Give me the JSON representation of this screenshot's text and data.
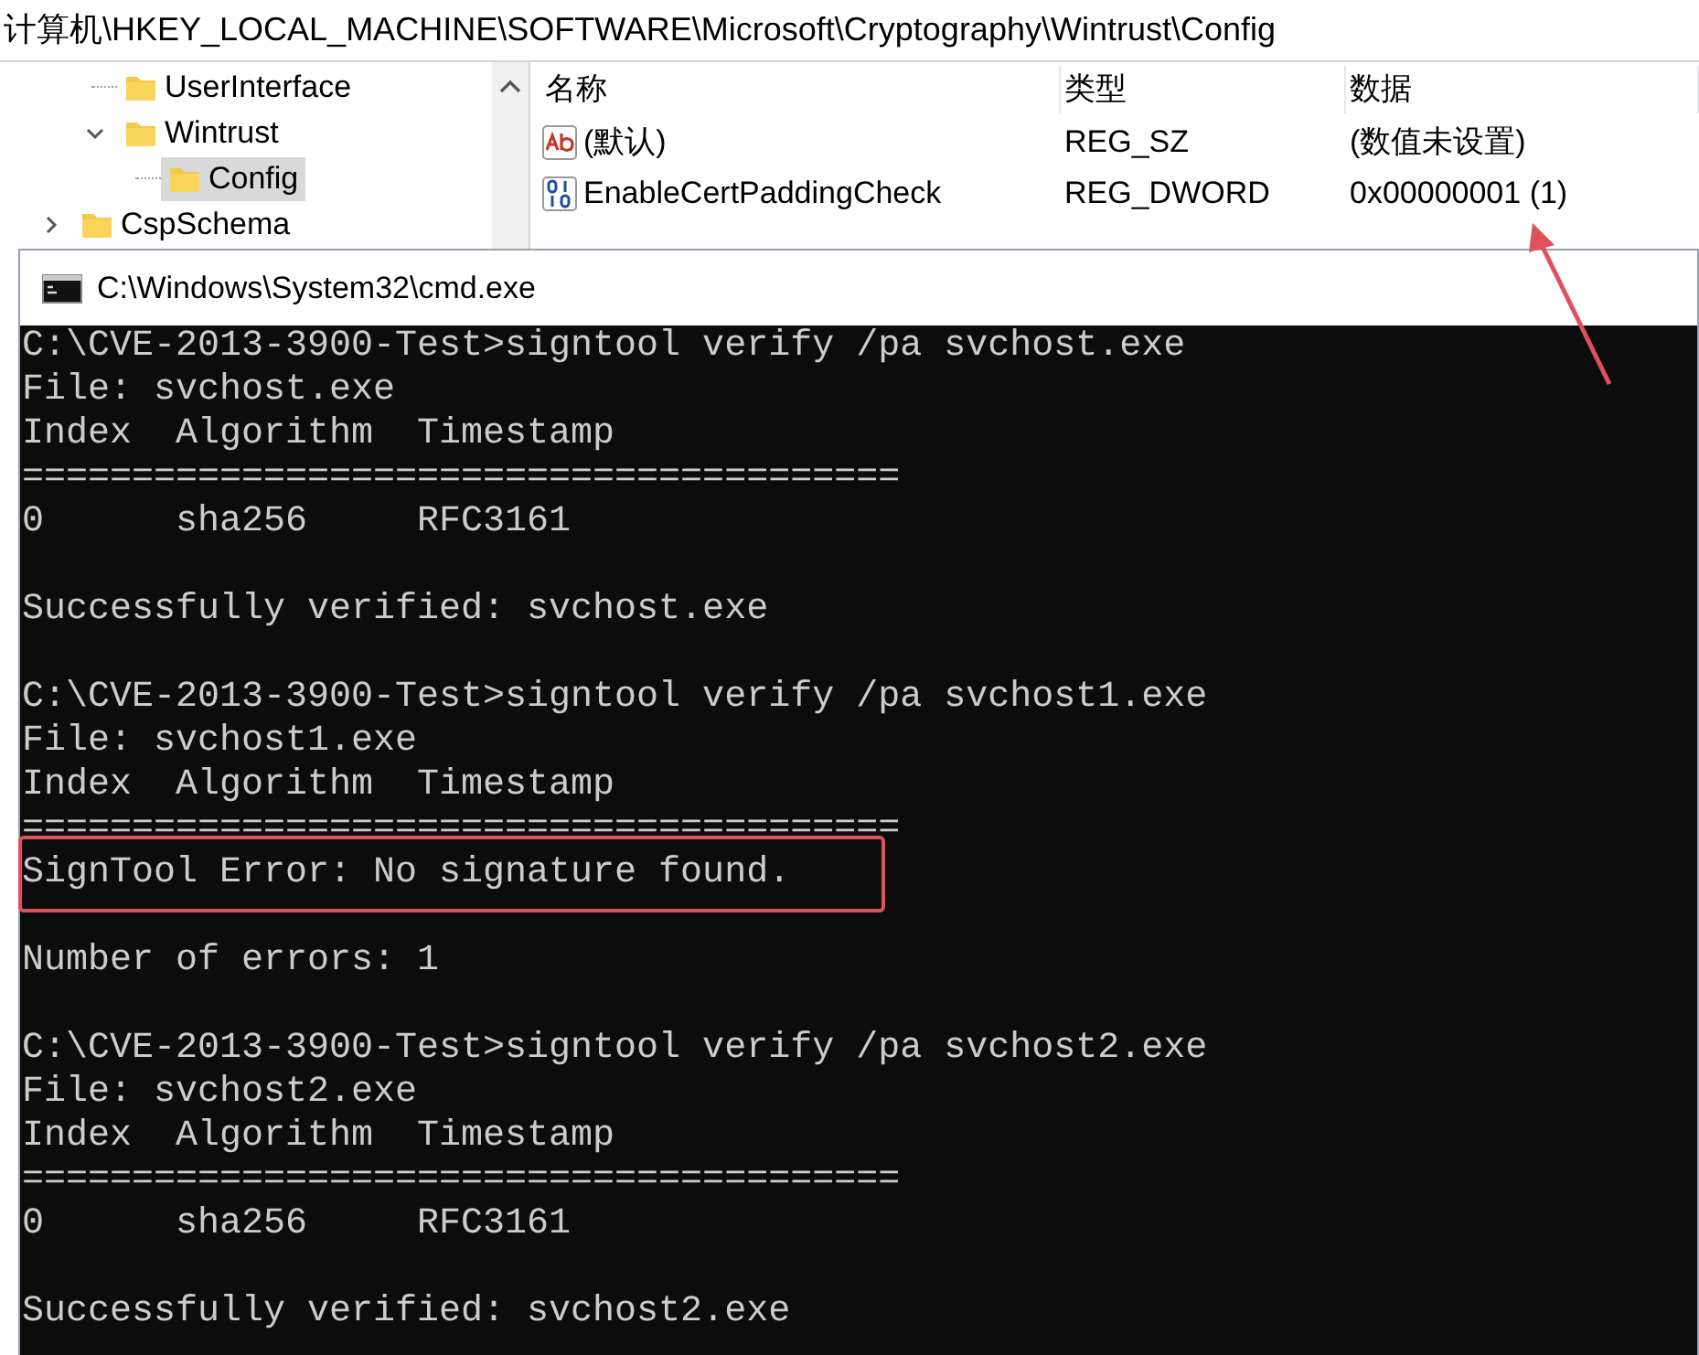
{
  "address_bar": "计算机\\HKEY_LOCAL_MACHINE\\SOFTWARE\\Microsoft\\Cryptography\\Wintrust\\Config",
  "tree": {
    "items": [
      {
        "kind": "hidden_parent",
        "children": [
          {
            "kind": "folder",
            "label": "UserInterface",
            "selected": false
          },
          {
            "kind": "folder",
            "label": "Wintrust",
            "expanded": true,
            "selected": false,
            "children": [
              {
                "kind": "folder",
                "label": "Config",
                "selected": true
              }
            ]
          }
        ]
      },
      {
        "kind": "folder",
        "label": "CspSchema",
        "expanded": false,
        "selected": false
      }
    ]
  },
  "values_list": {
    "columns": [
      "名称",
      "类型",
      "数据"
    ],
    "rows": [
      {
        "kind": "string",
        "name": "(默认)",
        "type": "REG_SZ",
        "data": "(数值未设置)"
      },
      {
        "kind": "binary",
        "name": "EnableCertPaddingCheck",
        "type": "REG_DWORD",
        "data": "0x00000001 (1)"
      }
    ]
  },
  "console": {
    "title": "C:\\Windows\\System32\\cmd.exe",
    "lines": [
      {
        "kind": "line",
        "text": "C:\\CVE-2013-3900-Test>signtool verify /pa svchost.exe"
      },
      {
        "kind": "line",
        "text": "File: svchost.exe"
      },
      {
        "kind": "line",
        "text": "Index  Algorithm  Timestamp"
      },
      {
        "kind": "line",
        "text": "========================================"
      },
      {
        "kind": "line",
        "text": "0      sha256     RFC3161"
      },
      {
        "kind": "blank"
      },
      {
        "kind": "line",
        "text": "Successfully verified: svchost.exe"
      },
      {
        "kind": "blank"
      },
      {
        "kind": "line",
        "text": "C:\\CVE-2013-3900-Test>signtool verify /pa svchost1.exe"
      },
      {
        "kind": "line",
        "text": "File: svchost1.exe"
      },
      {
        "kind": "line",
        "text": "Index  Algorithm  Timestamp"
      },
      {
        "kind": "line",
        "text": "========================================"
      },
      {
        "kind": "highlighted",
        "text": "SignTool Error: No signature found."
      },
      {
        "kind": "blank"
      },
      {
        "kind": "line",
        "text": "Number of errors: 1"
      },
      {
        "kind": "blank"
      },
      {
        "kind": "line",
        "text": "C:\\CVE-2013-3900-Test>signtool verify /pa svchost2.exe"
      },
      {
        "kind": "line",
        "text": "File: svchost2.exe"
      },
      {
        "kind": "line",
        "text": "Index  Algorithm  Timestamp"
      },
      {
        "kind": "line",
        "text": "========================================"
      },
      {
        "kind": "line",
        "text": "0      sha256     RFC3161"
      },
      {
        "kind": "blank"
      },
      {
        "kind": "line",
        "text": "Successfully verified: svchost2.exe"
      }
    ]
  }
}
